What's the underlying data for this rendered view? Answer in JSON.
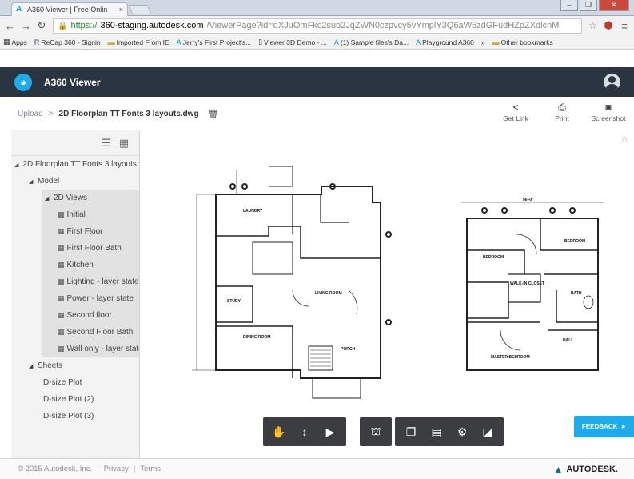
{
  "browser": {
    "tab_title": "A360 Viewer | Free Onlin",
    "tab_close": "×",
    "win_min": "‒",
    "win_max": "❐",
    "win_close": "✕",
    "url_secure": "https://",
    "url_host": "360-staging.autodesk.com",
    "url_path": "/ViewerPage?id=dXJuOmFkc2sub2JqZWN0czpvcy5vYmplY3Q6aW5zdGFudHZpZXdlcnM",
    "bookmarks": [
      {
        "icon": "apps-icon",
        "label": "Apps"
      },
      {
        "icon": "recap-icon",
        "label": "ReCap 360 - Signin"
      },
      {
        "icon": "folder-icon",
        "label": "Imported From IE"
      },
      {
        "icon": "autodesk-icon",
        "label": "Jerry's First Project's..."
      },
      {
        "icon": "page-icon",
        "label": "Viewer 3D Demo - ..."
      },
      {
        "icon": "autodesk-icon",
        "label": "(1) Sample files's Da..."
      },
      {
        "icon": "autodesk-icon",
        "label": "Playground A360"
      },
      {
        "icon": "folder-icon",
        "label": "Other bookmarks"
      }
    ]
  },
  "app": {
    "title": "A360 Viewer"
  },
  "breadcrumb": {
    "root": "Upload",
    "separator": ">",
    "file": "2D Floorplan TT Fonts 3 layouts.dwg"
  },
  "actions": {
    "get_link": "Get Link",
    "print": "Print",
    "screenshot": "Screenshot"
  },
  "tree": {
    "root": "2D Floorplan TT Fonts 3 layouts.dwg",
    "model": "Model",
    "views_group": "2D Views",
    "views": [
      "Initial",
      "First Floor",
      "First Floor Bath",
      "Kitchen",
      "Lighting - layer state",
      "Power - layer state",
      "Second floor",
      "Second Floor Bath",
      "Wall only - layer state"
    ],
    "sheets_group": "Sheets",
    "sheets": [
      "D-size Plot",
      "D-size Plot (2)",
      "D-size Plot (3)"
    ]
  },
  "plan": {
    "rooms": [
      "LAUNDRY",
      "STUDY",
      "DINING ROOM",
      "LIVING ROOM",
      "PORCH",
      "BEDROOM",
      "BEDROOM",
      "WALK-IN CLOSET",
      "MASTER BEDROOM",
      "HALL",
      "BATH"
    ],
    "dimension_label": "56'-0\""
  },
  "feedback_label": "FEEDBACK",
  "footer": {
    "copyright": "© 2015 Autodesk, Inc.",
    "privacy": "Privacy",
    "terms": "Terms",
    "separator": "|",
    "brand": "AUTODESK."
  },
  "colors": {
    "app_header": "#2b3441",
    "accent": "#1faaeb",
    "toolbar": "#3b3d40"
  }
}
